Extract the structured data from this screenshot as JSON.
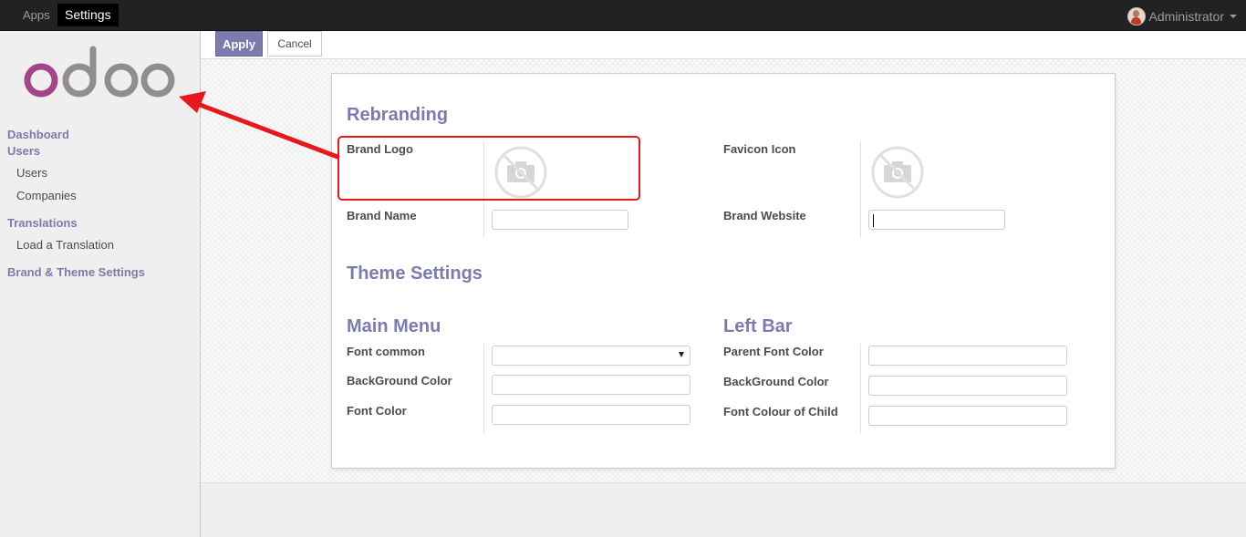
{
  "topbar": {
    "apps_label": "Apps",
    "settings_label": "Settings",
    "user_name": "Administrator"
  },
  "sidebar": {
    "logo_text": "odoo",
    "dashboard": "Dashboard",
    "users_section": "Users",
    "users": "Users",
    "companies": "Companies",
    "translations_section": "Translations",
    "load_translation": "Load a Translation",
    "brand_theme": "Brand & Theme Settings"
  },
  "control_panel": {
    "apply_label": "Apply",
    "cancel_label": "Cancel"
  },
  "form": {
    "rebranding_title": "Rebranding",
    "brand_logo_label": "Brand Logo",
    "favicon_label": "Favicon Icon",
    "brand_name_label": "Brand Name",
    "brand_name_value": "",
    "brand_website_label": "Brand Website",
    "brand_website_value": "",
    "theme_settings_title": "Theme Settings",
    "main_menu_title": "Main Menu",
    "left_bar_title": "Left Bar",
    "font_common_label": "Font common",
    "font_common_value": "",
    "mm_background_label": "BackGround Color",
    "mm_background_value": "",
    "mm_font_color_label": "Font Color",
    "mm_font_color_value": "",
    "parent_font_label": "Parent Font Color",
    "parent_font_value": "",
    "lb_background_label": "BackGround Color",
    "lb_background_value": "",
    "child_font_label": "Font Colour of Child",
    "child_font_value": ""
  },
  "colors": {
    "accent": "#7c7bad",
    "annotation": "#e3191c",
    "topbar": "#222222"
  }
}
